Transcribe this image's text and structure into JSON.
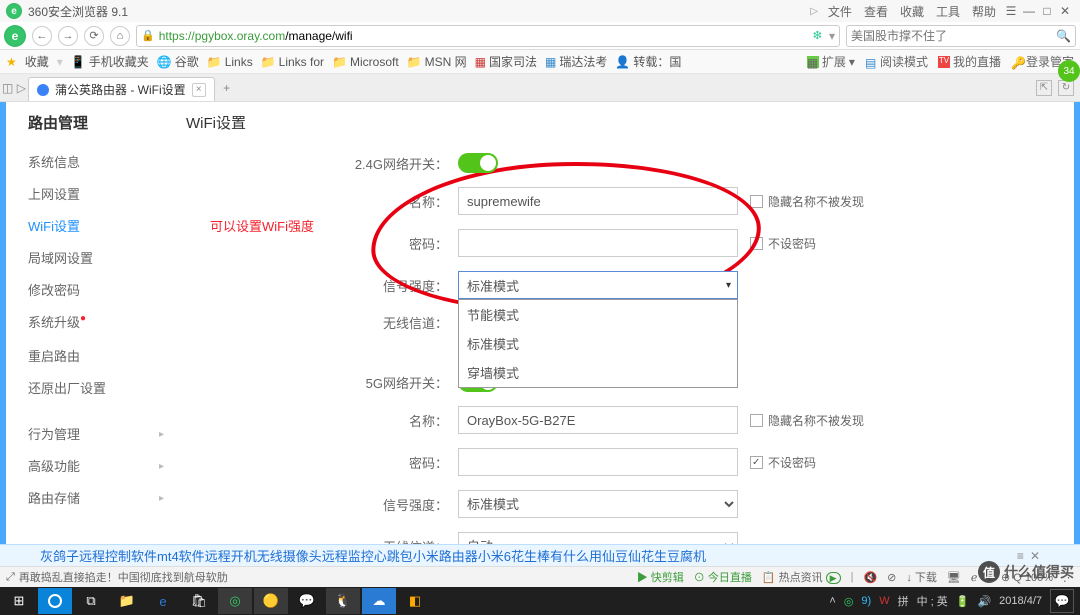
{
  "browser": {
    "title": "360安全浏览器 9.1",
    "menus": [
      "文件",
      "查看",
      "收藏",
      "工具",
      "帮助"
    ],
    "url_display": {
      "https": "https",
      "host": "://pgybox.oray.com",
      "path": "/manage/wifi"
    },
    "search_placeholder": "美国股市撑不住了"
  },
  "bookmarks": {
    "fav": "收藏",
    "items": [
      "手机收藏夹",
      "谷歌",
      "Links",
      "Links for",
      "Microsoft",
      "MSN 网",
      "国家司法",
      "瑞达法考",
      "转载：国"
    ],
    "ext": {
      "kuozhan": "扩展",
      "read": "阅读模式",
      "live": "我的直播",
      "admin": "登录管家"
    }
  },
  "tab": {
    "title": "蒲公英路由器 - WiFi设置"
  },
  "sidebar": {
    "heading": "路由管理",
    "items": [
      "系统信息",
      "上网设置",
      "WiFi设置",
      "局域网设置",
      "修改密码",
      "系统升级",
      "重启路由",
      "还原出厂设置"
    ],
    "items2": [
      "行为管理",
      "高级功能",
      "路由存储"
    ]
  },
  "page": {
    "title": "WiFi设置",
    "annotation": "可以设置WiFi强度",
    "g24": {
      "switch_label": "2.4G网络开关：",
      "name_label": "名称：",
      "name_value": "supremewife",
      "pwd_label": "密码：",
      "signal_label": "信号强度：",
      "signal_value": "标准模式",
      "signal_options": [
        "节能模式",
        "标准模式",
        "穿墙模式"
      ],
      "channel_label": "无线信道：",
      "hide_label": "隐藏名称不被发现",
      "nopwd_label": "不设密码"
    },
    "g5": {
      "switch_label": "5G网络开关：",
      "name_label": "名称：",
      "name_value": "OrayBox-5G-B27E",
      "pwd_label": "密码：",
      "signal_label": "信号强度：",
      "signal_value": "标准模式",
      "channel_label": "无线信道：",
      "channel_value": "自动",
      "hide_label": "隐藏名称不被发现",
      "nopwd_label": "不设密码"
    }
  },
  "linkbar": [
    "灰鸽子远程控制软件",
    "mt4软件",
    "远程开机",
    "无线摄像头远程监控",
    "心跳包",
    "小米路由器",
    "小米6",
    "花生棒有什么用",
    "仙豆仙花生豆腐机"
  ],
  "statusbar": {
    "left": "再敢捣乱直接掐走！中国彻底找到航母软肋",
    "fast": "快剪辑",
    "today": "今日直播",
    "hot": "热点资讯",
    "dl": "↓ 下载",
    "l2": "ℯ",
    "l3": "ℓ",
    "zoom": "⊕ Q 100%"
  },
  "watermark": "什么值得买",
  "taskbar": {
    "tray": {
      "pinyin": "拼",
      "lang": "中 ; 英",
      "time": "2018/4/7",
      "nine": "9)",
      "w": "W"
    }
  }
}
